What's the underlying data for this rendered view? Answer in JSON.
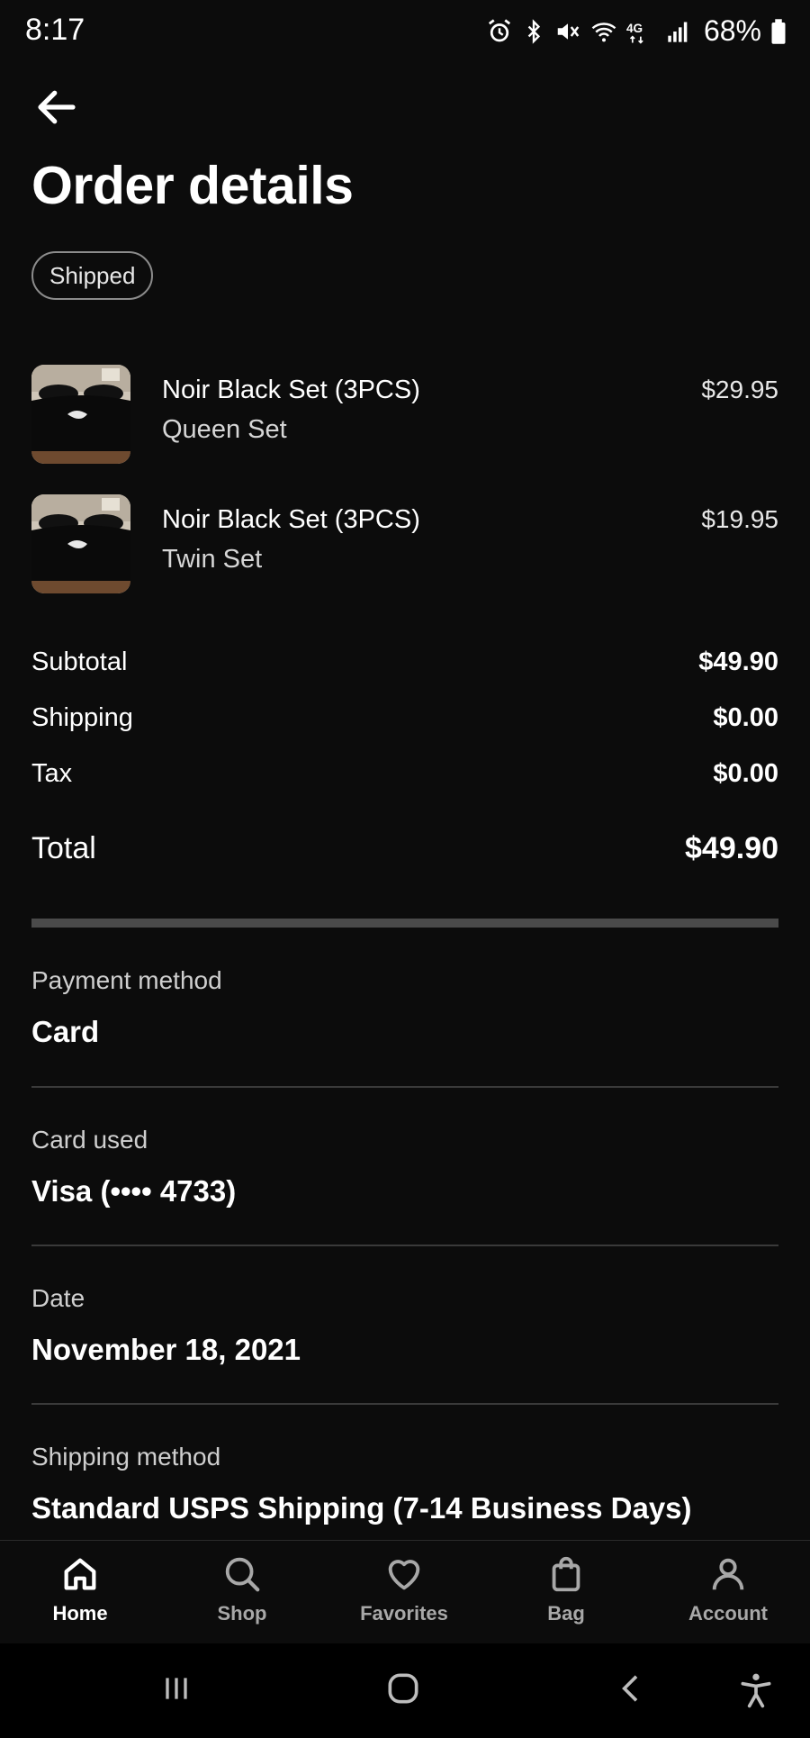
{
  "status_bar": {
    "time": "8:17",
    "battery": "68%",
    "icons": [
      "alarm-icon",
      "bluetooth-icon",
      "mute-icon",
      "wifi-icon",
      "4g-icon",
      "signal-icon",
      "battery-icon"
    ]
  },
  "header": {
    "back_icon": "arrow-left-icon",
    "title": "Order details",
    "status_badge": "Shipped"
  },
  "items": [
    {
      "name": "Noir Black Set (3PCS)",
      "variant": "Queen Set",
      "price": "$29.95"
    },
    {
      "name": "Noir Black Set (3PCS)",
      "variant": "Twin Set",
      "price": "$19.95"
    }
  ],
  "summary": {
    "subtotal_label": "Subtotal",
    "subtotal_value": "$49.90",
    "shipping_label": "Shipping",
    "shipping_value": "$0.00",
    "tax_label": "Tax",
    "tax_value": "$0.00",
    "total_label": "Total",
    "total_value": "$49.90"
  },
  "details": {
    "payment_label": "Payment method",
    "payment_value": "Card",
    "card_label": "Card used",
    "card_value": "Visa (•••• 4733)",
    "date_label": "Date",
    "date_value": "November 18, 2021",
    "shipping_method_label": "Shipping method",
    "shipping_method_value": "Standard USPS Shipping (7-14 Business Days)"
  },
  "bottom_nav": {
    "items": [
      {
        "label": "Home",
        "icon": "home-icon",
        "active": true
      },
      {
        "label": "Shop",
        "icon": "search-icon"
      },
      {
        "label": "Favorites",
        "icon": "heart-icon"
      },
      {
        "label": "Bag",
        "icon": "bag-icon"
      },
      {
        "label": "Account",
        "icon": "person-icon"
      }
    ]
  },
  "system_nav": [
    "recents-icon",
    "home-circle-icon",
    "back-chevron-icon",
    "accessibility-icon"
  ],
  "colors": {
    "background": "#0c0c0c",
    "text": "#ffffff",
    "muted": "#cfcfcf",
    "divider": "#3a3a3a"
  }
}
